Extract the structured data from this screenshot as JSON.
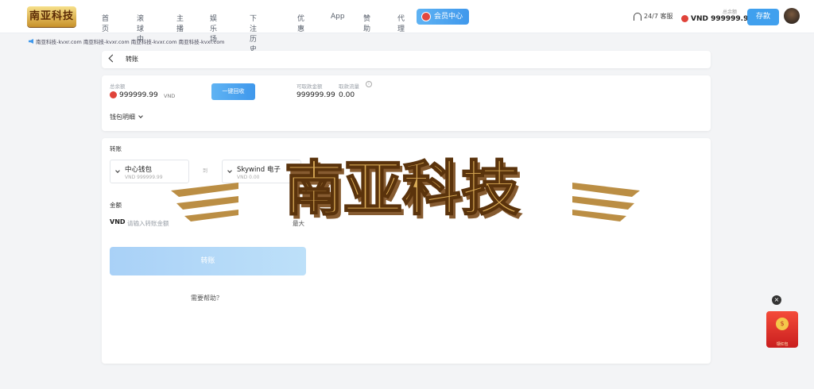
{
  "header": {
    "logo_text": "南亚科技",
    "nav": [
      "首页",
      "滚球中",
      "主播",
      "娱乐场",
      "下注历史",
      "优惠",
      "App",
      "赞助",
      "代理"
    ],
    "member_center": "会员中心",
    "support": "24/7 客服",
    "balance_label": "总余额",
    "balance": "VND 999999.99",
    "deposit": "存款"
  },
  "ticker": "南亚科技-kvxr.com 南亚科技-kvxr.com 南亚科技-kvxr.com 南亚科技-kvxr.com",
  "page": {
    "title": "转账"
  },
  "summary": {
    "total_label": "总余额",
    "total_value": "999999.99",
    "total_unit": "VND",
    "recall_button": "一键回收",
    "withdrawable_label": "可取款金额",
    "withdrawable_value": "999999.99",
    "withdraw_limit_label": "取款流量",
    "withdraw_limit_value": "0.00",
    "wallet_details": "钱包明细"
  },
  "transfer": {
    "section_label": "转账",
    "from_name": "中心钱包",
    "from_balance": "VND 999999.99",
    "to_label": "到",
    "to_name": "Skywind 电子",
    "to_balance": "VND 0.00",
    "amount_label": "金额",
    "currency": "VND",
    "amount_placeholder": "请输入转账金额",
    "max_label": "最大",
    "submit": "转账",
    "help": "需要帮助？"
  },
  "watermark": {
    "text": "南亚科技"
  },
  "float_redpack": {
    "label": "领红包"
  },
  "colors": {
    "accent": "#3f98ec",
    "accent_light": "#a9d1f7",
    "coin": "#e0433a"
  }
}
